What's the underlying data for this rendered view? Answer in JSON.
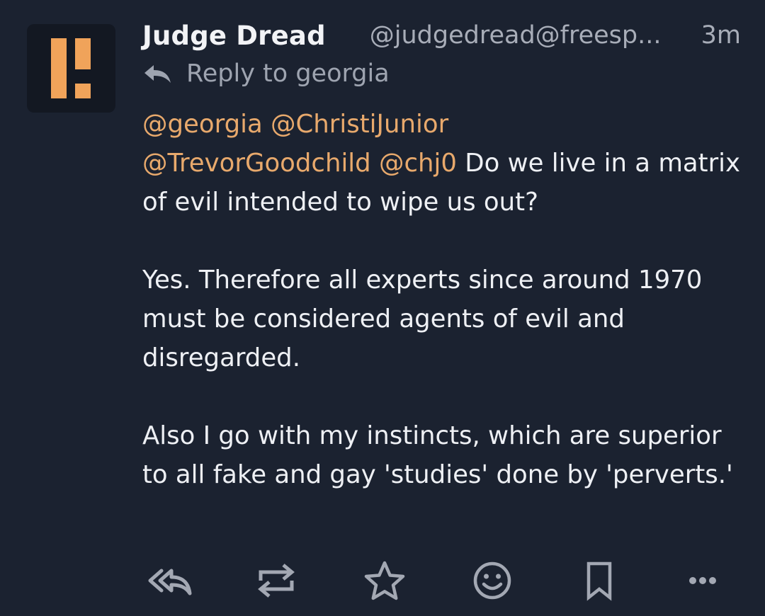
{
  "post": {
    "author": {
      "display_name": "Judge Dread",
      "acct": "@judgedread@freesp...",
      "avatar_icon": "logo-icon"
    },
    "time": "3m",
    "reply_to": "Reply to georgia",
    "mentions_line1": [
      "@georgia",
      "@ChristiJunior"
    ],
    "mentions_line2": [
      "@TrevorGoodchild",
      "@chj0"
    ],
    "paragraphs": [
      "Do we live in a matrix of evil intended to wipe us out?",
      "Yes. Therefore all experts since around 1970 must be considered agents of evil and disregarded.",
      "Also I go with my instincts, which are superior to all fake and gay 'studies' done by 'perverts.'"
    ],
    "actions": [
      {
        "name": "reply-all-icon"
      },
      {
        "name": "boost-icon"
      },
      {
        "name": "favourite-icon"
      },
      {
        "name": "emoji-reaction-icon"
      },
      {
        "name": "bookmark-icon"
      },
      {
        "name": "more-icon"
      }
    ]
  },
  "colors": {
    "background": "#1b2230",
    "mention": "#e8a96c",
    "logo_orange": "#f0a35a",
    "muted": "#a8adb8"
  }
}
